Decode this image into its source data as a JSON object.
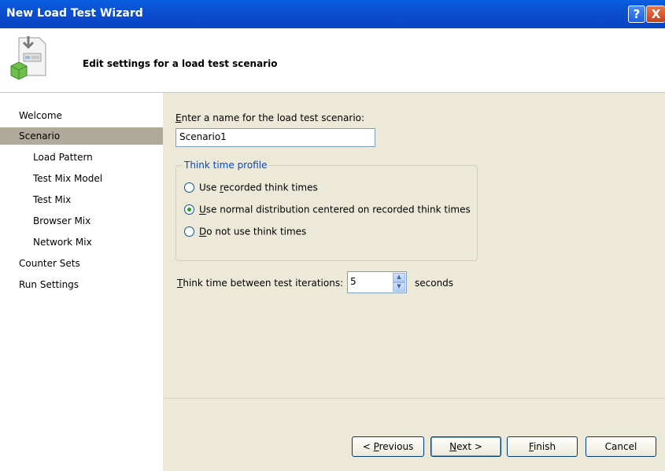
{
  "window": {
    "title": "New Load Test Wizard",
    "help_glyph": "?",
    "close_glyph": "X"
  },
  "header": {
    "title": "Edit settings for a load test scenario",
    "icon": "wizard-document-icon"
  },
  "nav": {
    "items": [
      {
        "label": "Welcome"
      },
      {
        "label": "Scenario"
      },
      {
        "label": "Load Pattern"
      },
      {
        "label": "Test Mix Model"
      },
      {
        "label": "Test Mix"
      },
      {
        "label": "Browser Mix"
      },
      {
        "label": "Network Mix"
      },
      {
        "label": "Counter Sets"
      },
      {
        "label": "Run Settings"
      }
    ],
    "selected": "Scenario"
  },
  "content": {
    "name_label": {
      "u": "E",
      "rest": "nter a name for the load test scenario:"
    },
    "name_value": "Scenario1",
    "think_group_title": "Think time profile",
    "radios": [
      {
        "pre": "Use ",
        "u": "r",
        "post": "ecorded think times",
        "checked": false
      },
      {
        "pre": "",
        "u": "U",
        "post": "se normal distribution centered on recorded think times",
        "checked": true
      },
      {
        "pre": "",
        "u": "D",
        "post": "o not use think times",
        "checked": false
      }
    ],
    "iteration_label": {
      "u": "T",
      "rest": "hink time between test iterations:"
    },
    "iteration_value": "5",
    "iteration_unit": "seconds"
  },
  "buttons": {
    "previous": {
      "pre": "< ",
      "u": "P",
      "post": "revious"
    },
    "next": {
      "pre": "",
      "u": "N",
      "post": "ext >"
    },
    "finish": {
      "pre": "",
      "u": "F",
      "post": "inish"
    },
    "cancel": {
      "pre": "",
      "u": "",
      "post": "Cancel"
    }
  },
  "colors": {
    "titlebar": "#0a4fd0",
    "selected_nav": "#b0aa9a",
    "content_bg": "#ece9d8",
    "group_title": "#0046d5",
    "radio_dot": "#21a121"
  }
}
